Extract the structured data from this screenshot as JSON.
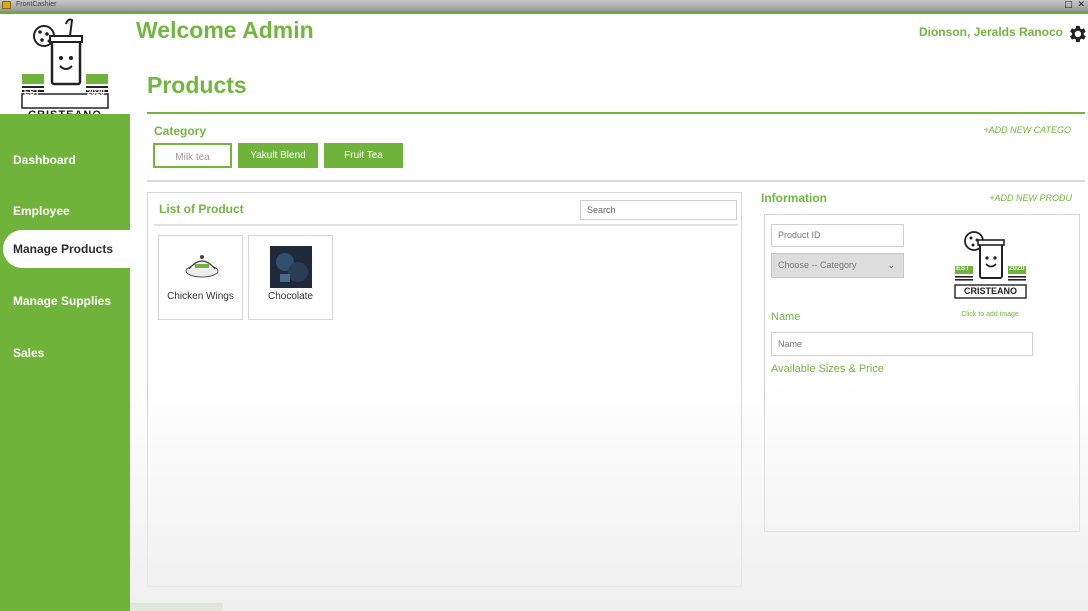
{
  "window": {
    "title": "FrontCashier"
  },
  "colors": {
    "accent": "#6fb33b",
    "text_green": "#72b63f"
  },
  "logo": {
    "est": "EST",
    "year": "2020",
    "brand": "CRISTEANO"
  },
  "header": {
    "welcome": "Welcome Admin",
    "user_name": "Dionson, Jeralds Ranoco",
    "settings_icon": "gear-icon"
  },
  "sidebar": {
    "items": [
      {
        "label": "Dashboard",
        "active": false
      },
      {
        "label": "Employee",
        "active": false
      },
      {
        "label": "Manage Products",
        "active": true
      },
      {
        "label": "Manage Supplies",
        "active": false
      },
      {
        "label": "Sales",
        "active": false
      }
    ]
  },
  "page": {
    "title": "Products"
  },
  "category": {
    "label": "Category",
    "add_link": "+ADD NEW CATEGO",
    "items": [
      {
        "label": "Milk tea",
        "selected": false
      },
      {
        "label": "Yakult Blend",
        "selected": true
      },
      {
        "label": "Fruit Tea",
        "selected": true
      }
    ]
  },
  "product_list": {
    "title": "List of Product",
    "search_placeholder": "Search",
    "products": [
      {
        "name": "Chicken Wings"
      },
      {
        "name": "Chocolate"
      }
    ]
  },
  "information": {
    "label": "Information",
    "add_link": "+ADD NEW PRODU",
    "product_id_placeholder": "Product ID",
    "category_select_value": "Choose -- Category",
    "name_label": "Name",
    "name_placeholder": "Name",
    "sizes_label": "Available Sizes & Price",
    "click_to_add_image": "Click to add image"
  }
}
